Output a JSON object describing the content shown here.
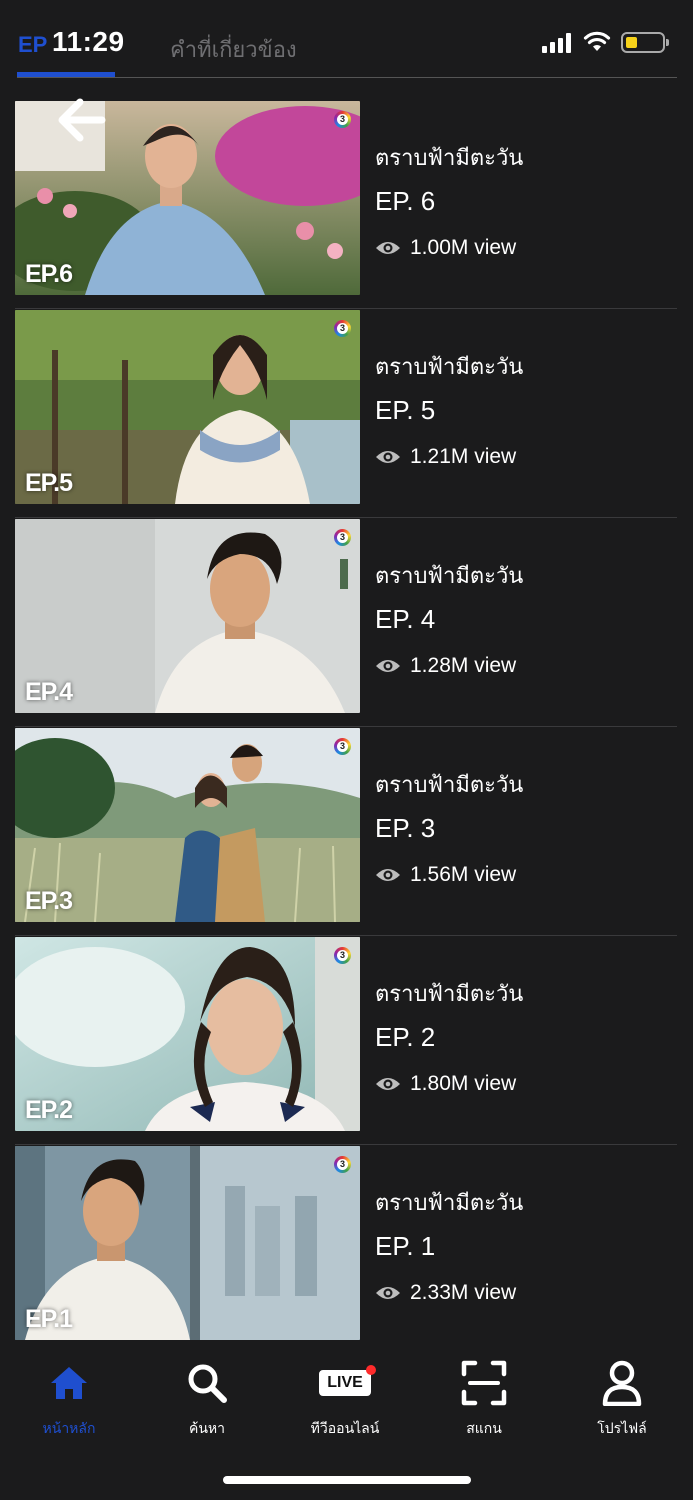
{
  "status_bar": {
    "time": "11:29",
    "battery_color": "#f7d21a"
  },
  "tabs": [
    {
      "label": "EP",
      "active": true
    },
    {
      "label": "คำที่เกี่ยวข้อง",
      "active": false
    }
  ],
  "accent_color": "#1f4fcf",
  "episodes": [
    {
      "badge": "EP.6",
      "title": "ตราบฟ้ามีตะวัน",
      "episode": "EP. 6",
      "views": "1.00M view"
    },
    {
      "badge": "EP.5",
      "title": "ตราบฟ้ามีตะวัน",
      "episode": "EP. 5",
      "views": "1.21M view"
    },
    {
      "badge": "EP.4",
      "title": "ตราบฟ้ามีตะวัน",
      "episode": "EP. 4",
      "views": "1.28M view"
    },
    {
      "badge": "EP.3",
      "title": "ตราบฟ้ามีตะวัน",
      "episode": "EP. 3",
      "views": "1.56M view"
    },
    {
      "badge": "EP.2",
      "title": "ตราบฟ้ามีตะวัน",
      "episode": "EP. 2",
      "views": "1.80M view"
    },
    {
      "badge": "EP.1",
      "title": "ตราบฟ้ามีตะวัน",
      "episode": "EP. 1",
      "views": "2.33M view"
    }
  ],
  "bottom_nav": [
    {
      "label": "หน้าหลัก",
      "icon": "home-icon",
      "active": true
    },
    {
      "label": "ค้นหา",
      "icon": "search-icon",
      "active": false
    },
    {
      "label": "ทีวีออนไลน์",
      "icon": "live-icon",
      "badge": "LIVE",
      "active": false
    },
    {
      "label": "สแกน",
      "icon": "scan-icon",
      "active": false
    },
    {
      "label": "โปรไฟล์",
      "icon": "profile-icon",
      "active": false
    }
  ]
}
